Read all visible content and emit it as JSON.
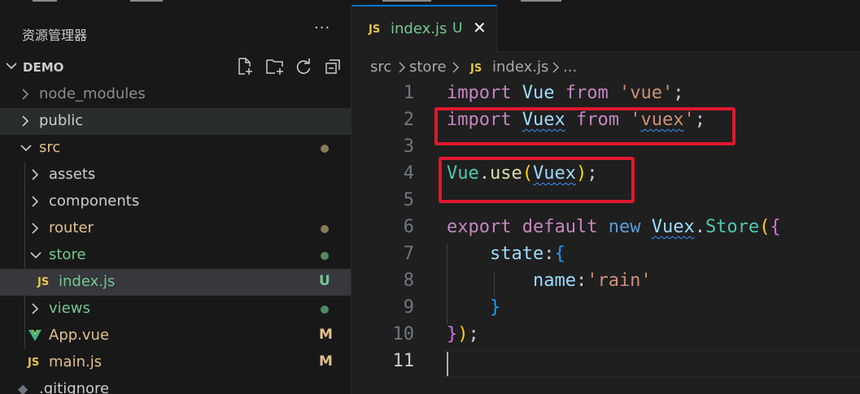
{
  "explorer": {
    "title": "资源管理器",
    "more": "···",
    "section": "DEMO",
    "tree": [
      {
        "label": "node_modules",
        "kind": "folder",
        "open": false,
        "color": "dim"
      },
      {
        "label": "public",
        "kind": "folder",
        "open": false,
        "color": "default"
      },
      {
        "label": "src",
        "kind": "folder",
        "open": true,
        "color": "mod",
        "status": "dot"
      },
      {
        "label": "assets",
        "kind": "folder",
        "open": false,
        "color": "default"
      },
      {
        "label": "components",
        "kind": "folder",
        "open": false,
        "color": "default"
      },
      {
        "label": "router",
        "kind": "folder",
        "open": false,
        "color": "mod",
        "status": "dot"
      },
      {
        "label": "store",
        "kind": "folder",
        "open": true,
        "color": "green",
        "status": "dot"
      },
      {
        "label": "index.js",
        "kind": "js",
        "color": "green",
        "badge": "U"
      },
      {
        "label": "views",
        "kind": "folder",
        "open": false,
        "color": "green",
        "status": "dot"
      },
      {
        "label": "App.vue",
        "kind": "vue",
        "color": "mod",
        "badge": "M"
      },
      {
        "label": "main.js",
        "kind": "js",
        "color": "mod",
        "badge": "M"
      },
      {
        "label": ".gitignore",
        "kind": "git",
        "color": "default"
      }
    ]
  },
  "icons": {
    "js": "JS",
    "new_file": "new-file-icon",
    "new_folder": "new-folder-icon",
    "refresh": "refresh-icon",
    "collapse": "collapse-all-icon"
  },
  "colors": {
    "accent": "#0078d4",
    "untracked": "#73c991",
    "modified": "#e2c08d",
    "highlight_box": "#e0182d"
  },
  "editor": {
    "tab": {
      "name": "index.js",
      "status": "U",
      "close": "✕"
    },
    "breadcrumb": [
      "src",
      "store",
      "index.js",
      "..."
    ],
    "line_numbers": [
      "1",
      "2",
      "3",
      "4",
      "5",
      "6",
      "7",
      "8",
      "9",
      "10",
      "11"
    ],
    "code": {
      "l1": [
        "import",
        "Vue",
        "from",
        "'vue'",
        ";"
      ],
      "l2": [
        "import",
        "Vuex",
        "from",
        "'",
        "vuex",
        "'",
        ";"
      ],
      "l4": [
        "Vue",
        ".",
        "use",
        "(",
        "Vuex",
        ")",
        ";"
      ],
      "l6": [
        "export",
        "default",
        "new",
        "Vuex",
        ".",
        "Store",
        "(",
        "{"
      ],
      "l7": [
        "state",
        ":",
        "{"
      ],
      "l8": [
        "name",
        ":",
        "'rain'"
      ],
      "l9": [
        "}"
      ],
      "l10": [
        "}",
        ")",
        ";"
      ]
    }
  }
}
